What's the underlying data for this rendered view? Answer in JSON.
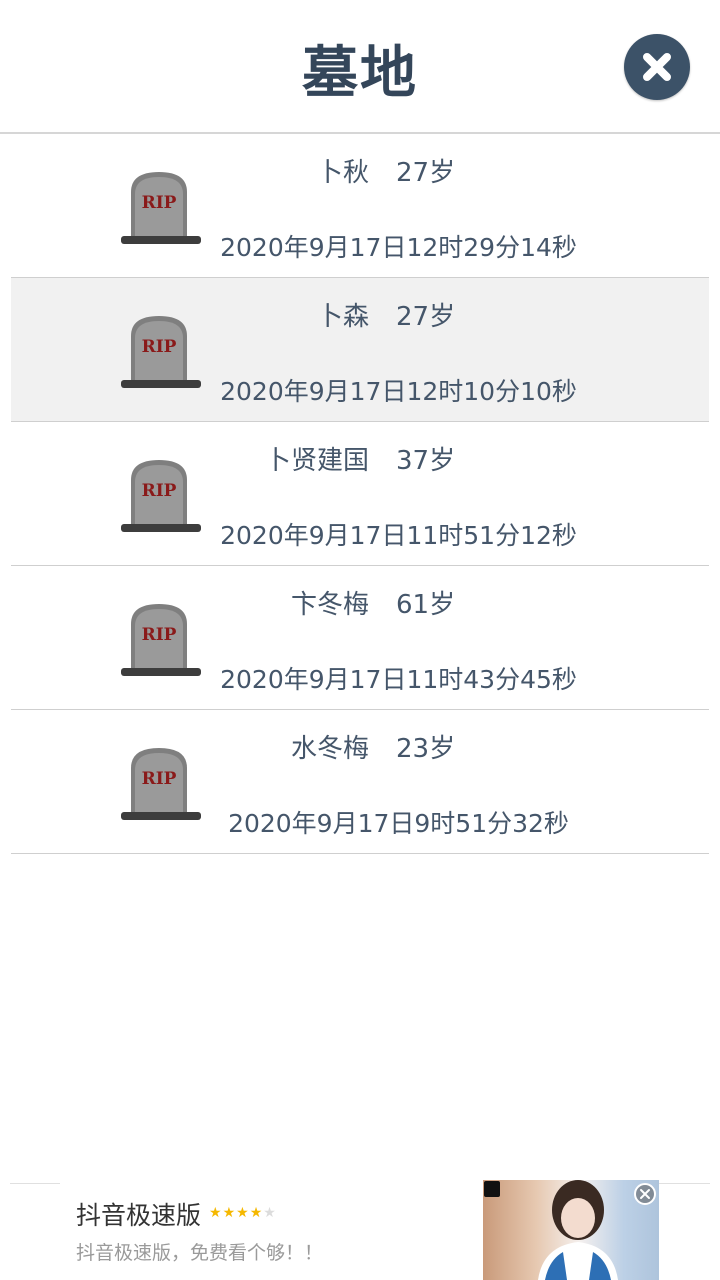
{
  "header": {
    "title": "墓地"
  },
  "graves": [
    {
      "name": "卜秋",
      "age": "27岁",
      "time": "2020年9月17日12时29分14秒"
    },
    {
      "name": "卜森",
      "age": "27岁",
      "time": "2020年9月17日12时10分10秒"
    },
    {
      "name": "卜贤建国",
      "age": "37岁",
      "time": "2020年9月17日11时51分12秒"
    },
    {
      "name": "卞冬梅",
      "age": "61岁",
      "time": "2020年9月17日11时43分45秒"
    },
    {
      "name": "水冬梅",
      "age": "23岁",
      "time": "2020年9月17日9时51分32秒"
    }
  ],
  "tombstone": {
    "label": "RIP"
  },
  "ad": {
    "app_name": "抖音极速版",
    "rating_stars": 4,
    "rating_max": 5,
    "description": "抖音极速版，免费看个够！！"
  },
  "colors": {
    "title": "#34465a",
    "close_button": "#3c5268",
    "text": "#45566a",
    "alt_row": "#f1f1f1",
    "star": "#f5b800"
  },
  "icons": {
    "close": "close-icon",
    "tombstone": "tombstone-icon",
    "ad_close": "ad-close-icon"
  }
}
